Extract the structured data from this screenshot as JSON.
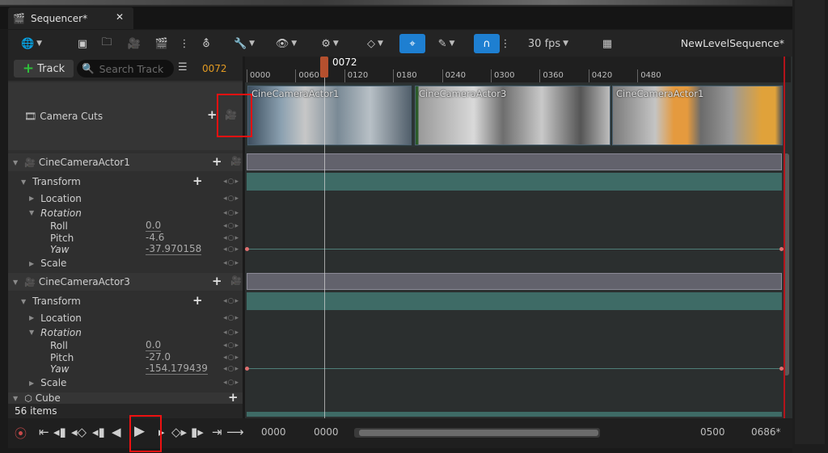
{
  "tab": {
    "title": "Sequencer*",
    "close": "✕"
  },
  "toolbar": {
    "fps": "30 fps",
    "sequence_name": "NewLevelSequence*"
  },
  "track_bar": {
    "add_label": "Track",
    "search_placeholder": "Search Track",
    "current_frame": "0072"
  },
  "ruler": {
    "ticks": [
      "0000",
      "0060",
      "0120",
      "0180",
      "0240",
      "0300",
      "0360",
      "0420",
      "0480"
    ],
    "playhead": "0072"
  },
  "camera_cuts": {
    "label": "Camera Cuts",
    "shots": [
      "CineCameraActor1",
      "CineCameraActor3",
      "CineCameraActor1"
    ]
  },
  "actor1": {
    "name": "CineCameraActor1",
    "transform": "Transform",
    "location": "Location",
    "rotation": "Rotation",
    "roll_label": "Roll",
    "roll": "0.0",
    "pitch_label": "Pitch",
    "pitch": "-4.6",
    "yaw_label": "Yaw",
    "yaw": "-37.970158",
    "scale": "Scale"
  },
  "actor3": {
    "name": "CineCameraActor3",
    "transform": "Transform",
    "location": "Location",
    "rotation": "Rotation",
    "roll_label": "Roll",
    "roll": "0.0",
    "pitch_label": "Pitch",
    "pitch": "-27.0",
    "yaw_label": "Yaw",
    "yaw": "-154.179439",
    "scale": "Scale"
  },
  "cube": {
    "name": "Cube"
  },
  "status": {
    "items": "56 items"
  },
  "transport": {
    "start_view": "0000",
    "start_play": "0000",
    "end_play": "0500",
    "end_view": "0686*"
  },
  "colors": {
    "accent": "#1e7fd1",
    "current_frame": "#e29a22",
    "transform_band": "#3e6b66",
    "highlight": "#ee1111"
  }
}
